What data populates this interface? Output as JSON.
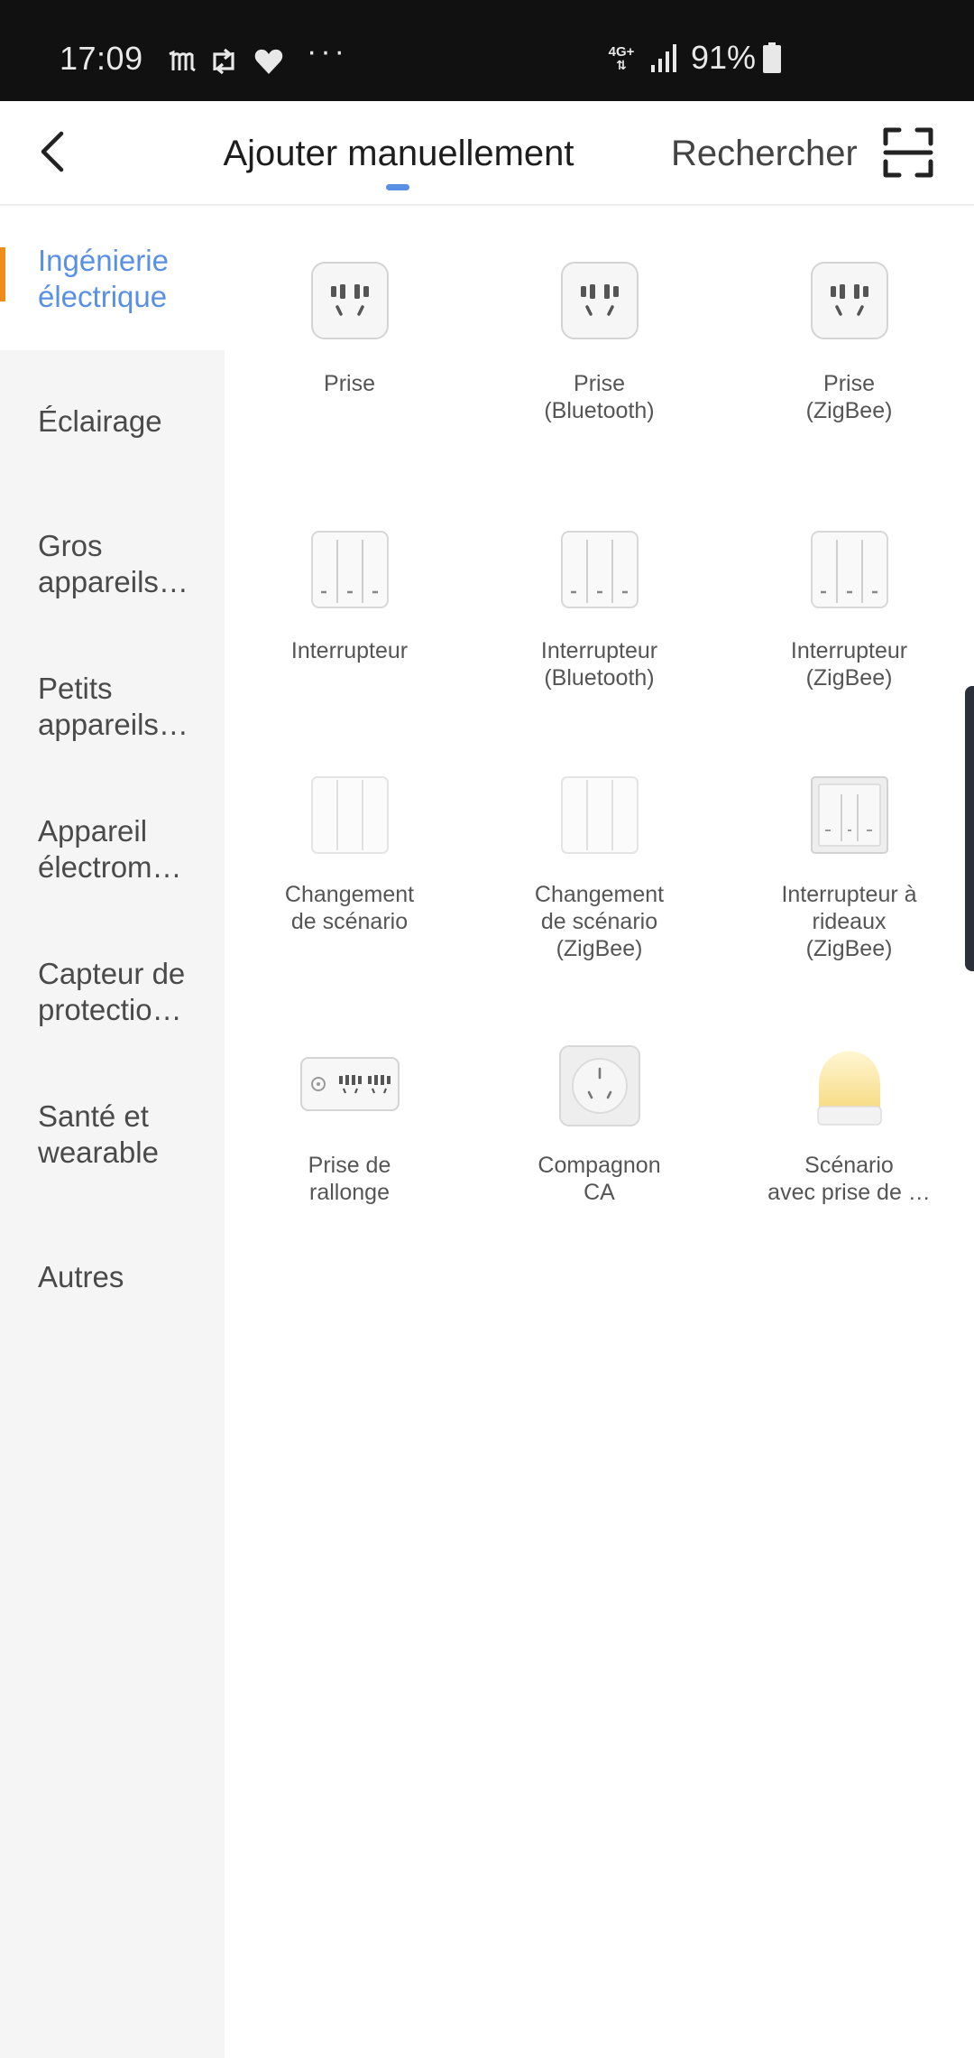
{
  "status": {
    "time": "17:09",
    "network": "4G+",
    "battery": "91%",
    "more": "···"
  },
  "header": {
    "tabs": [
      "Ajouter manuellement",
      "Rechercher"
    ],
    "icons": [
      "back-arrow-icon",
      "scan-icon"
    ],
    "accent": "#5a8fe6"
  },
  "sidebar": {
    "active_color": "#5a8fe6",
    "indicator_color": "#f08c1c",
    "items": [
      {
        "label": "Ingénierie\nélectrique"
      },
      {
        "label": "Éclairage"
      },
      {
        "label": "Gros\nappareils…"
      },
      {
        "label": "Petits\nappareils…"
      },
      {
        "label": "Appareil\nélectrom…"
      },
      {
        "label": "Capteur de\nprotectio…"
      },
      {
        "label": "Santé et\nwearable"
      },
      {
        "label": "Autres"
      }
    ]
  },
  "devices": [
    {
      "label": "Prise",
      "icon": "socket-icon"
    },
    {
      "label": "Prise\n(Bluetooth)",
      "icon": "socket-icon"
    },
    {
      "label": "Prise\n(ZigBee)",
      "icon": "socket-icon"
    },
    {
      "label": "Interrupteur",
      "icon": "wall-switch-icon"
    },
    {
      "label": "Interrupteur\n(Bluetooth)",
      "icon": "wall-switch-icon"
    },
    {
      "label": "Interrupteur\n(ZigBee)",
      "icon": "wall-switch-icon"
    },
    {
      "label": "Changement\nde scénario",
      "icon": "scene-switch-icon"
    },
    {
      "label": "Changement\nde scénario\n(ZigBee)",
      "icon": "scene-switch-icon"
    },
    {
      "label": "Interrupteur à\nrideaux\n(ZigBee)",
      "icon": "curtain-switch-icon"
    },
    {
      "label": "Prise de\nrallonge",
      "icon": "power-strip-icon"
    },
    {
      "label": "Compagnon\nCA",
      "icon": "ac-companion-icon"
    },
    {
      "label": "Scénario\navec prise de …",
      "icon": "night-lamp-icon"
    }
  ]
}
